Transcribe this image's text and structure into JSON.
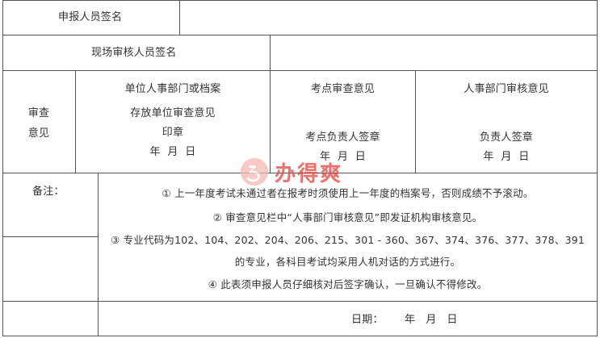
{
  "form": {
    "applicant_signature_label": "申报人员签名",
    "reviewer_signature_label": "现场审核人员签名",
    "review_opinion_label": [
      "审查",
      "意见"
    ],
    "unit_opinion": {
      "line1": "单位人事部门或档案",
      "line2": "存放单位审查意见",
      "line3": "印章",
      "date": "年  月  日"
    },
    "exam_site_opinion": {
      "title": "考点审查意见",
      "signer": "考点负责人签章",
      "date": "年  月  日"
    },
    "hr_opinion": {
      "title": "人事部门审核意见",
      "signer": "负责人签章",
      "date": "年  月  日"
    },
    "remarks_label": "备注：",
    "remarks": [
      "① 上一年度考试未通过者在报考时须使用上一年度的档案号，否则成绩不予滚动。",
      "② 审查意见栏中“人事部门审核意见”即发证机构审核意见。",
      "③ 专业代码为102、104、202、204、206、215、301 - 360、367、374、376、377、378、391",
      "的专业，各科目考试均采用人机对话的方式进行。",
      "④ 此表须申报人员仔细核对后签字确认，一旦确认不得修改。"
    ],
    "date_label": "日期：",
    "date_fields": "年   月   日"
  },
  "watermark": {
    "text": "办得爽",
    "color": "#e8413a"
  }
}
